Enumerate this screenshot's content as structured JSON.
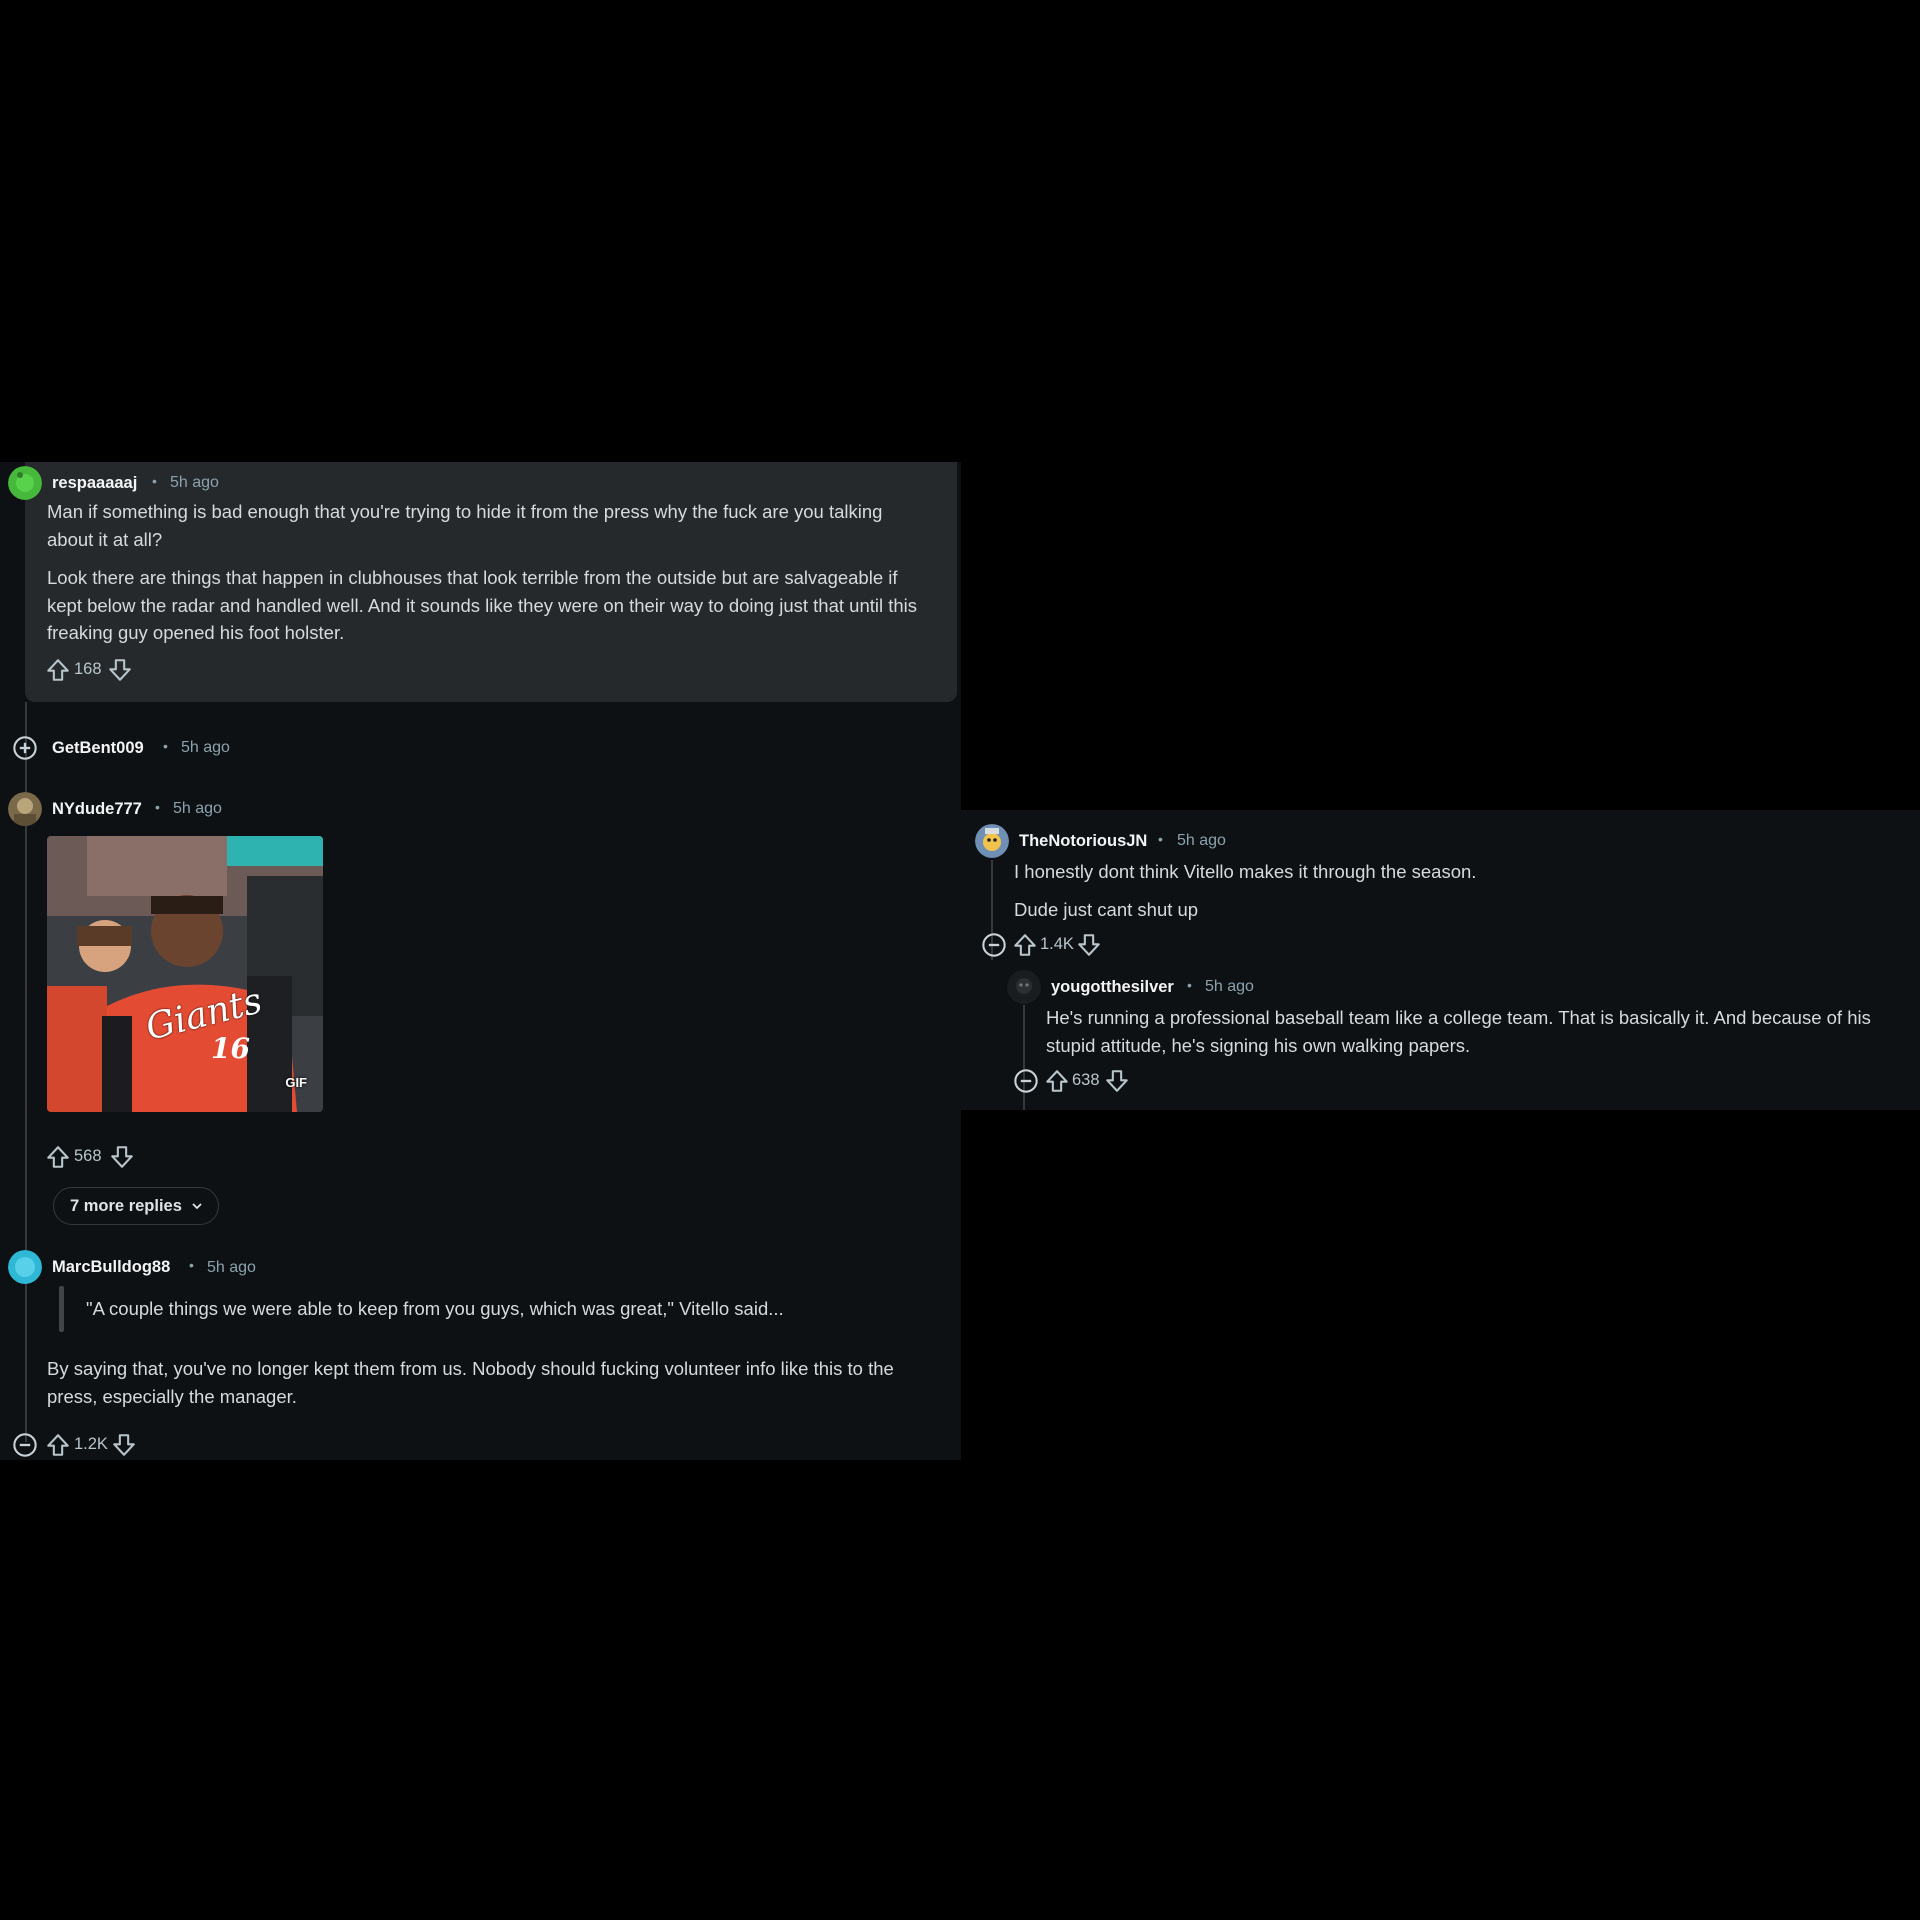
{
  "colors": {
    "background": "#0e1113",
    "highlight": "#25292c",
    "text": "#d7dadc",
    "meta": "#8ba2ad"
  },
  "comments": [
    {
      "username": "respaaaaaj",
      "time": "5h ago",
      "avatar": "green-avatar",
      "paragraphs": [
        "Man if something is bad enough that you're trying to hide it from the press why the fuck are you talking about it at all?",
        "Look there are things that happen in clubhouses that look terrible from the outside but are salvageable if kept below the radar and handled well. And it sounds like they were on their way to doing just that until this freaking guy opened his foot holster."
      ],
      "votes": "168"
    },
    {
      "username": "GetBent009",
      "time": "5h ago",
      "collapsed": true
    },
    {
      "username": "NYdude777",
      "time": "5h ago",
      "media": "Giants baseball players GIF",
      "media_label": "GIF",
      "jersey_text": "Giants",
      "jersey_number": "16",
      "votes": "568",
      "more_replies": "7 more replies"
    },
    {
      "username": "MarcBulldog88",
      "time": "5h ago",
      "quote": "\"A couple things we were able to keep from you guys, which was great,\" Vitello said...",
      "paragraphs": [
        "By saying that, you've no longer kept them from us. Nobody should fucking volunteer info like this to the press, especially the manager."
      ],
      "votes": "1.2K"
    },
    {
      "username": "TheNotoriousJN",
      "time": "5h ago",
      "paragraphs": [
        "I honestly dont think Vitello makes it through the season.",
        "Dude just cant shut up"
      ],
      "votes": "1.4K"
    },
    {
      "username": "yougotthesilver",
      "time": "5h ago",
      "paragraphs": [
        "He's running a professional baseball team like a college team. That is basically it. And because of his stupid attitude, he's signing his own walking papers."
      ],
      "votes": "638"
    }
  ]
}
